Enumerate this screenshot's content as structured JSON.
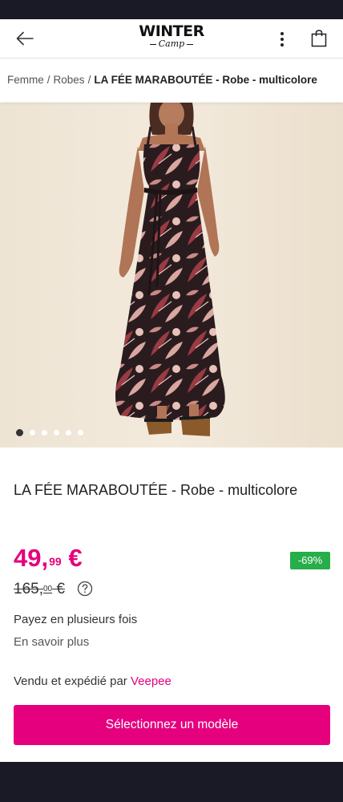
{
  "header": {
    "logo_top": "WINTER",
    "logo_bottom": "Camp"
  },
  "breadcrumb": {
    "items": [
      "Femme",
      "Robes"
    ],
    "current": "LA FÉE MARABOUTÉE - Robe - multicolore",
    "separator": "/"
  },
  "gallery": {
    "image_count": 6,
    "active_index": 0
  },
  "product": {
    "title": "LA FÉE MARABOUTÉE - Robe - multicolore",
    "price_main": "49,",
    "price_cents": "99",
    "price_currency": "€",
    "old_price_main": "165,",
    "old_price_cents": "00",
    "old_price_currency": "€",
    "discount": "-69%",
    "installments": "Payez en plusieurs fois",
    "learn_more": "En savoir plus",
    "sold_by_prefix": "Vendu et expédié par",
    "seller": "Veepee",
    "cta": "Sélectionnez un modèle"
  },
  "colors": {
    "accent": "#e5007e",
    "discount": "#27ad4a",
    "system_bar": "#1a1a26"
  },
  "icons": [
    "back-arrow-icon",
    "more-vert-icon",
    "shopping-bag-icon",
    "help-circle-icon"
  ]
}
